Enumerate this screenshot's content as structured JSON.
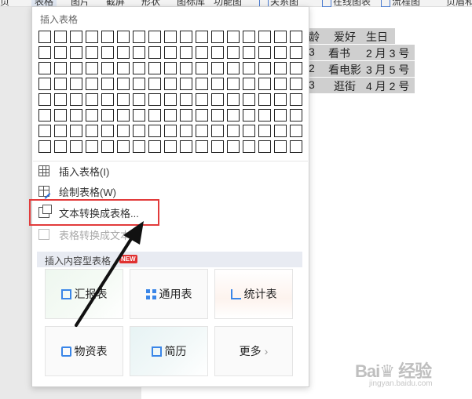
{
  "toolbar": {
    "items": [
      "表格",
      "图片",
      "截屏",
      "形状",
      "图标库",
      "功能图",
      "关系图",
      "在线图表",
      "流程图",
      "页眉和"
    ]
  },
  "document": {
    "rows": [
      [
        "龄",
        "爱好",
        "生日"
      ],
      [
        "3",
        "看书",
        "2 月 3 号"
      ],
      [
        "2",
        "看电影",
        "3 月 5 号"
      ],
      [
        "3",
        "逛街",
        "4 月 2 号"
      ]
    ]
  },
  "dropdown": {
    "header": "插入表格",
    "menu": {
      "insert_table": "插入表格(I)",
      "draw_table": "绘制表格(W)",
      "text_to_table": "文本转换成表格...",
      "table_to_text": "表格转换成文本..."
    },
    "section": {
      "label": "插入内容型表格",
      "badge": "NEW"
    },
    "cards": {
      "summary": "汇报表",
      "general": "通用表",
      "statistics": "统计表",
      "materials": "物资表",
      "resume": "简历",
      "more": "更多",
      "more_chevron": "›"
    }
  },
  "watermark": {
    "main": "Bai♛ 经验",
    "sub": "jingyan.baidu.com"
  },
  "colors": {
    "highlight": "#e23b3b",
    "accent": "#3a86e8",
    "badge": "#e03131"
  }
}
